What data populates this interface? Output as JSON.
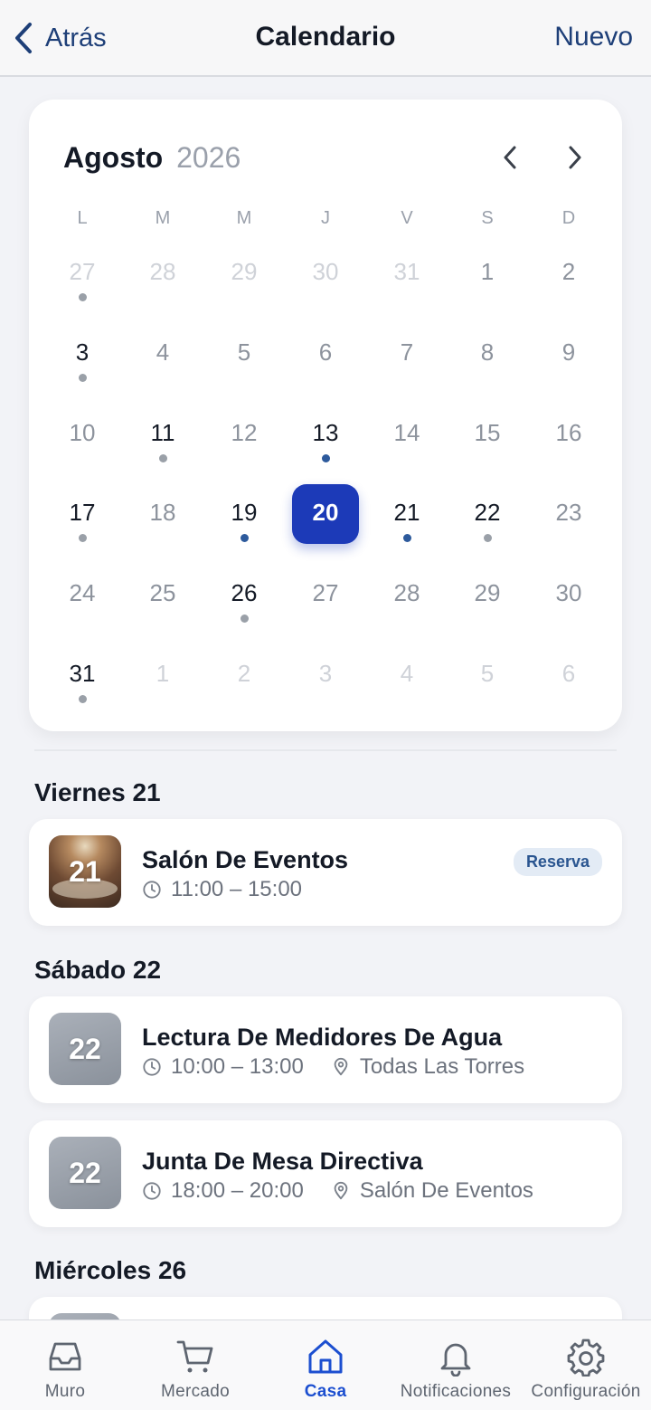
{
  "header": {
    "back_label": "Atrás",
    "title": "Calendario",
    "new_label": "Nuevo"
  },
  "calendar": {
    "month": "Agosto",
    "year": "2026",
    "weekdays": [
      "L",
      "M",
      "M",
      "J",
      "V",
      "S",
      "D"
    ],
    "weeks": [
      [
        {
          "d": "27",
          "state": "other",
          "dot": "gray"
        },
        {
          "d": "28",
          "state": "other"
        },
        {
          "d": "29",
          "state": "other"
        },
        {
          "d": "30",
          "state": "other"
        },
        {
          "d": "31",
          "state": "other"
        },
        {
          "d": "1",
          "state": "muted"
        },
        {
          "d": "2",
          "state": "muted"
        }
      ],
      [
        {
          "d": "3",
          "state": "event",
          "dot": "gray"
        },
        {
          "d": "4",
          "state": "muted"
        },
        {
          "d": "5",
          "state": "muted"
        },
        {
          "d": "6",
          "state": "muted"
        },
        {
          "d": "7",
          "state": "muted"
        },
        {
          "d": "8",
          "state": "muted"
        },
        {
          "d": "9",
          "state": "muted"
        }
      ],
      [
        {
          "d": "10",
          "state": "muted"
        },
        {
          "d": "11",
          "state": "event",
          "dot": "gray"
        },
        {
          "d": "12",
          "state": "muted"
        },
        {
          "d": "13",
          "state": "event",
          "dot": "blue"
        },
        {
          "d": "14",
          "state": "muted"
        },
        {
          "d": "15",
          "state": "muted"
        },
        {
          "d": "16",
          "state": "muted"
        }
      ],
      [
        {
          "d": "17",
          "state": "event",
          "dot": "gray"
        },
        {
          "d": "18",
          "state": "muted"
        },
        {
          "d": "19",
          "state": "event",
          "dot": "blue"
        },
        {
          "d": "20",
          "state": "selected"
        },
        {
          "d": "21",
          "state": "event",
          "dot": "blue"
        },
        {
          "d": "22",
          "state": "event",
          "dot": "gray"
        },
        {
          "d": "23",
          "state": "muted"
        }
      ],
      [
        {
          "d": "24",
          "state": "muted"
        },
        {
          "d": "25",
          "state": "muted"
        },
        {
          "d": "26",
          "state": "event",
          "dot": "gray"
        },
        {
          "d": "27",
          "state": "muted"
        },
        {
          "d": "28",
          "state": "muted"
        },
        {
          "d": "29",
          "state": "muted"
        },
        {
          "d": "30",
          "state": "muted"
        }
      ],
      [
        {
          "d": "31",
          "state": "event",
          "dot": "gray"
        },
        {
          "d": "1",
          "state": "other"
        },
        {
          "d": "2",
          "state": "other"
        },
        {
          "d": "3",
          "state": "other"
        },
        {
          "d": "4",
          "state": "other"
        },
        {
          "d": "5",
          "state": "other"
        },
        {
          "d": "6",
          "state": "other"
        }
      ]
    ]
  },
  "sections": [
    {
      "title": "Viernes 21",
      "events": [
        {
          "day": "21",
          "name": "Salón De Eventos",
          "time": "11:00 – 15:00",
          "location": "",
          "badge": "Reserva",
          "thumb": "photo"
        }
      ]
    },
    {
      "title": "Sábado 22",
      "events": [
        {
          "day": "22",
          "name": "Lectura De Medidores De Agua",
          "time": "10:00 – 13:00",
          "location": "Todas Las Torres",
          "badge": "",
          "thumb": "gray"
        },
        {
          "day": "22",
          "name": "Junta De Mesa Directiva",
          "time": "18:00 – 20:00",
          "location": "Salón De Eventos",
          "badge": "",
          "thumb": "gray"
        }
      ]
    },
    {
      "title": "Miércoles 26",
      "events": []
    }
  ],
  "tabbar": {
    "items": [
      {
        "label": "Muro",
        "icon": "inbox-icon",
        "active": false
      },
      {
        "label": "Mercado",
        "icon": "cart-icon",
        "active": false
      },
      {
        "label": "Casa",
        "icon": "home-icon",
        "active": true
      },
      {
        "label": "Notificaciones",
        "icon": "bell-icon",
        "active": false
      },
      {
        "label": "Configuración",
        "icon": "gear-icon",
        "active": false
      }
    ]
  },
  "colors": {
    "accent": "#1c3ab8",
    "link": "#1e3f78",
    "tab_active": "#1c4fd0",
    "dot_blue": "#2d5a9c",
    "dot_gray": "#9aa0a8"
  }
}
